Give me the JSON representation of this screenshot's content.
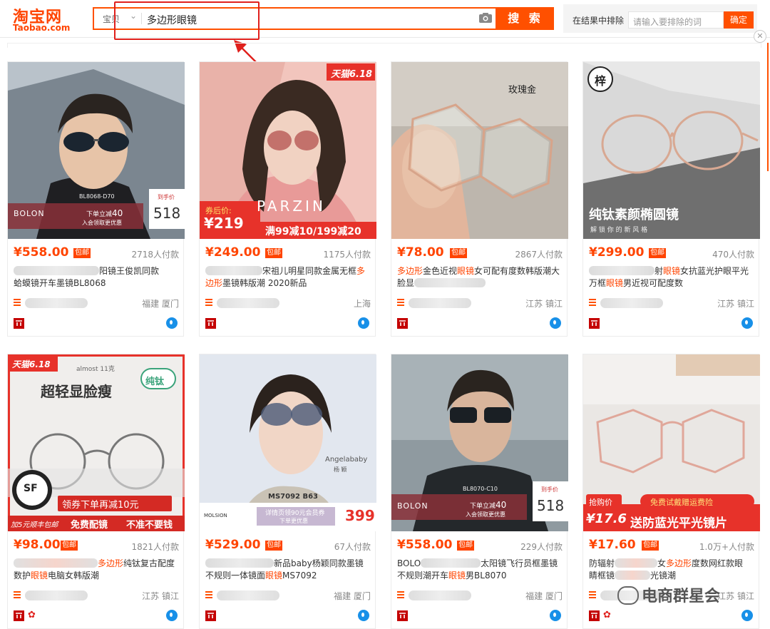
{
  "header": {
    "logo_cn": "淘宝网",
    "logo_en": "Taobao.com",
    "search_category": "宝贝",
    "search_query": "多边形眼镜",
    "search_button": "搜 索",
    "exclude_label": "在结果中排除",
    "exclude_placeholder": "请输入要排除的词",
    "exclude_button": "确定"
  },
  "colors": {
    "accent": "#ff5000",
    "price": "#ff4400",
    "highlight": "#e0201c"
  },
  "products": [
    {
      "price": "¥558.00",
      "baoyou": "包邮",
      "buyers": "2718人付款",
      "title_a": "阳镜王俊凯同款",
      "title_b": "蛤蟆镜开车墨镜BL8068",
      "location": "福建 厦门",
      "img_brand": "BOLON",
      "img_model": "BL8068-D70",
      "img_promo": "下单立减",
      "img_promo_val": "40",
      "img_promo2": "入会领取更优惠",
      "img_price_label": "到手价",
      "img_price": "518"
    },
    {
      "price": "¥249.00",
      "baoyou": "包邮",
      "buyers": "1175人付款",
      "title_a": "宋祖儿明星同款金属无框",
      "title_hl": "多",
      "title_hl2": "边形",
      "title_b": "墨镜韩版潮 2020新品",
      "location": "上海",
      "img_tag": "天猫6.18",
      "img_brand": "PARZIN",
      "img_coupon": "券后价:",
      "img_price": "¥219",
      "img_promo": "满99减10/199减20"
    },
    {
      "price": "¥78.00",
      "baoyou": "包邮",
      "buyers": "2867人付款",
      "title_hl": "多边形",
      "title_a": "金色近视",
      "title_hl2": "眼镜",
      "title_b": "女可配有度数韩版潮大",
      "title_c": "脸显",
      "location": "江苏 镇江",
      "img_brand": "玫瑰金"
    },
    {
      "price": "¥299.00",
      "baoyou": "包邮",
      "buyers": "470人付款",
      "title_a": "射",
      "title_hl": "眼镜",
      "title_b": "女抗蓝光护眼平光",
      "title_c": "万框",
      "title_hl2": "眼镜",
      "title_d": "男近视可配度数",
      "location": "江苏 镇江",
      "img_logo": "梓",
      "img_headline": "纯钛素颜椭圆镜",
      "img_sub": "解 锁 你 的 新 风 格"
    },
    {
      "price": "¥98.00",
      "baoyou": "包邮",
      "buyers": "1821人付款",
      "title_hl": "多边形",
      "title_a": "纯钛复古配度",
      "title_b": "数护",
      "title_hl2": "眼镜",
      "title_c": "电脑女韩版潮",
      "location": "江苏 镇江",
      "img_tag": "天猫6.18",
      "img_weight": "almost 11克",
      "img_headline": "超轻显脸瘦",
      "img_badge": "纯钛",
      "img_sf": "SF",
      "img_promo": "领券下单再减10元",
      "img_bottom1": "加5元顺丰包邮",
      "img_bottom2": "免费配镜",
      "img_bottom3": "不准不要钱"
    },
    {
      "price": "¥529.00",
      "baoyou": "包邮",
      "buyers": "67人付款",
      "title_a": "新品baby杨颖同款墨镜",
      "title_b": "不规则一体镜面",
      "title_hl": "眼镜",
      "title_c": "MS7092",
      "location": "福建 厦门",
      "img_name_en": "Angelababy",
      "img_name_cn": "杨 颖",
      "img_model": "MS7092 B63",
      "img_brand": "MOLSION",
      "img_promo": "详情页领90元会员券",
      "img_promo2": "下单更优惠",
      "img_price": "399"
    },
    {
      "price": "¥558.00",
      "baoyou": "包邮",
      "buyers": "229人付款",
      "title_a": "BOLO",
      "title_b": "太阳镜飞行员框墨镜",
      "title_c": "不规则潮开车",
      "title_hl": "眼镜",
      "title_d": "男BL8070",
      "location": "福建 厦门",
      "img_brand": "BOLON",
      "img_model": "BL8070-C10",
      "img_promo": "下单立减",
      "img_promo_val": "40",
      "img_promo2": "入会领取更优惠",
      "img_price_label": "到手价",
      "img_price": "518"
    },
    {
      "price": "¥17.60",
      "baoyou": "包邮",
      "buyers": "1.0万+人付款",
      "title_a": "防辐射",
      "title_b": "女",
      "title_hl": "多边形",
      "title_c": "度数网红款眼",
      "title_d": "睛框镜",
      "title_e": "光镜潮",
      "location": "江苏 镇江",
      "img_promo_top": "免费试戴赠运费险",
      "img_coupon": "抢购价",
      "img_price": "¥17.6",
      "img_promo": "送防蓝光平光镜片"
    }
  ],
  "watermark": "电商群星会"
}
